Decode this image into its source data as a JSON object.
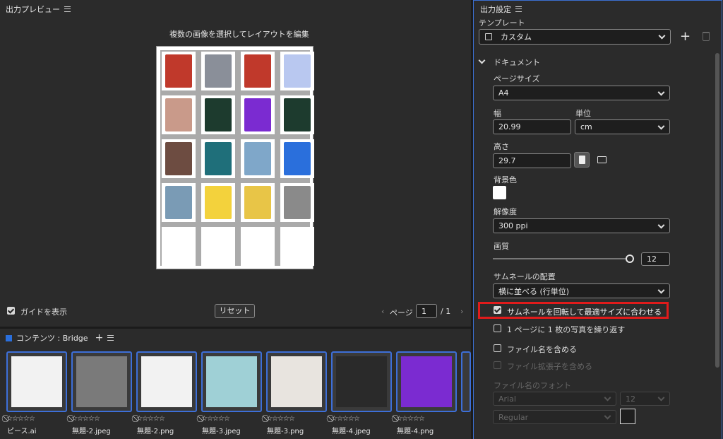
{
  "preview_panel": {
    "title": "出力プレビュー",
    "caption": "複数の画像を選択してレイアウトを編集",
    "guide_label": "ガイドを表示",
    "reset_label": "リセット",
    "page_label": "ページ",
    "page_value": "1",
    "page_total": "/ 1"
  },
  "content_panel": {
    "title": "コンテンツ : Bridge",
    "add_icon": "plus-icon",
    "items": [
      {
        "name": "ピース.ai",
        "color": "#f2f2f2"
      },
      {
        "name": "無題-2.jpeg",
        "color": "#7a7a7a"
      },
      {
        "name": "無題-2.png",
        "color": "#f2f2f2"
      },
      {
        "name": "無題-3.jpeg",
        "color": "#9fd0d6"
      },
      {
        "name": "無題-3.png",
        "color": "#e8e4df"
      },
      {
        "name": "無題-4.jpeg",
        "color": "#2a2a2a"
      },
      {
        "name": "無題-4.png",
        "color": "#7b2bd1"
      }
    ],
    "rating": "⃠☆☆☆☆☆"
  },
  "settings_panel": {
    "title": "出力設定",
    "template_label": "テンプレート",
    "template_value": "カスタム",
    "section_document": "ドキュメント",
    "page_size_label": "ページサイズ",
    "page_size_value": "A4",
    "width_label": "幅",
    "width_value": "20.99",
    "unit_label": "単位",
    "unit_value": "cm",
    "height_label": "高さ",
    "height_value": "29.7",
    "bg_label": "背景色",
    "resolution_label": "解像度",
    "resolution_value": "300 ppi",
    "quality_label": "画質",
    "quality_value": "12",
    "placement_label": "サムネールの配置",
    "placement_value": "横に並べる (行単位)",
    "rotate_fit_label": "サムネールを回転して最適サイズに合わせる",
    "repeat_label": "1 ページに 1 枚の写真を繰り返す",
    "include_filename_label": "ファイル名を含める",
    "include_ext_label": "ファイル拡張子を含める",
    "font_label": "ファイル名のフォント",
    "font_value": "Arial",
    "font_size_value": "12",
    "font_style_value": "Regular"
  },
  "colors": {
    "highlight_red": "#e01b1b",
    "film_border": "#3d6fd8",
    "bridge_square": "#2a6fdc"
  },
  "sheet_thumbs": [
    "#c0392b",
    "#8a8f99",
    "#c0392b",
    "#b9c8f0",
    "#c99a8a",
    "#1d3b2e",
    "#7b2bd1",
    "#1d3b2e",
    "#6d4c41",
    "#1f6f7a",
    "#7fa7c9",
    "#2a6fdc",
    "#7a9bb5",
    "#f3d23c",
    "#e8c547",
    "#8a8a8a"
  ]
}
